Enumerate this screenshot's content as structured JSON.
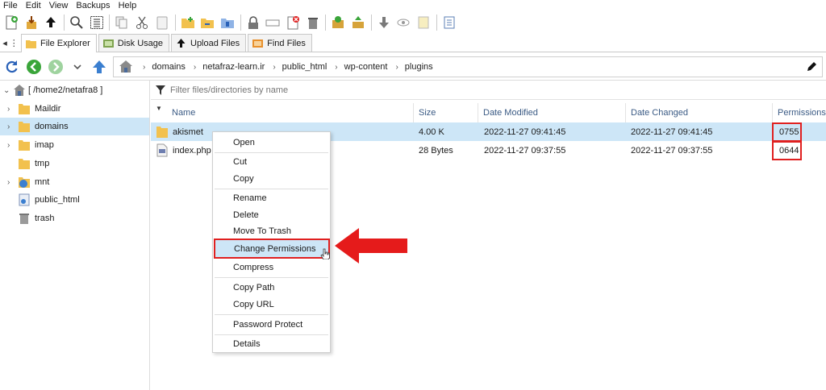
{
  "menubar": {
    "items": [
      "File",
      "Edit",
      "View",
      "Backups",
      "Help"
    ]
  },
  "toolbar": {
    "icons": [
      "new-file-icon",
      "download-icon",
      "upload-icon",
      "search-icon",
      "select-all-icon",
      "copy-icon",
      "cut-icon",
      "paste-icon",
      "new-folder-icon",
      "move-icon",
      "compress-icon",
      "permissions-icon",
      "rename-icon",
      "edit-icon",
      "delete-icon",
      "extract-icon",
      "upload-file-icon",
      "down-icon",
      "view-icon",
      "notes-icon",
      "checklist-icon"
    ]
  },
  "tabs": [
    {
      "label": "File Explorer",
      "active": true
    },
    {
      "label": "Disk Usage",
      "active": false
    },
    {
      "label": "Upload Files",
      "active": false
    },
    {
      "label": "Find Files",
      "active": false
    }
  ],
  "breadcrumb": [
    "domains",
    "netafraz-learn.ir",
    "public_html",
    "wp-content",
    "plugins"
  ],
  "tree": {
    "root": "[ /home2/netafra8 ]",
    "items": [
      {
        "label": "Maildir",
        "expandable": true,
        "selected": false
      },
      {
        "label": "domains",
        "expandable": true,
        "selected": true
      },
      {
        "label": "imap",
        "expandable": true,
        "selected": false
      },
      {
        "label": "tmp",
        "expandable": false,
        "selected": false
      },
      {
        "label": "mnt",
        "expandable": true,
        "selected": false
      },
      {
        "label": "public_html",
        "expandable": false,
        "selected": false
      },
      {
        "label": "trash",
        "expandable": false,
        "selected": false
      }
    ]
  },
  "filter": {
    "placeholder": "Filter files/directories by name"
  },
  "columns": {
    "name": "Name",
    "size": "Size",
    "modified": "Date Modified",
    "changed": "Date Changed",
    "permissions": "Permissions"
  },
  "files": [
    {
      "name": "akismet",
      "size": "4.00 K",
      "modified": "2022-11-27 09:41:45",
      "changed": "2022-11-27 09:41:45",
      "permissions": "0755",
      "type": "folder",
      "selected": true
    },
    {
      "name": "index.php",
      "size": "28 Bytes",
      "modified": "2022-11-27 09:37:55",
      "changed": "2022-11-27 09:37:55",
      "permissions": "0644",
      "type": "file",
      "selected": false
    }
  ],
  "context_menu": {
    "open": "Open",
    "cut": "Cut",
    "copy": "Copy",
    "rename": "Rename",
    "delete": "Delete",
    "move_to_trash": "Move To Trash",
    "change_permissions": "Change Permissions",
    "compress": "Compress",
    "copy_path": "Copy Path",
    "copy_url": "Copy URL",
    "password_protect": "Password Protect",
    "details": "Details"
  },
  "colors": {
    "selection": "#cde6f7",
    "highlight_red": "#e02020",
    "header_text": "#3a5a84"
  }
}
